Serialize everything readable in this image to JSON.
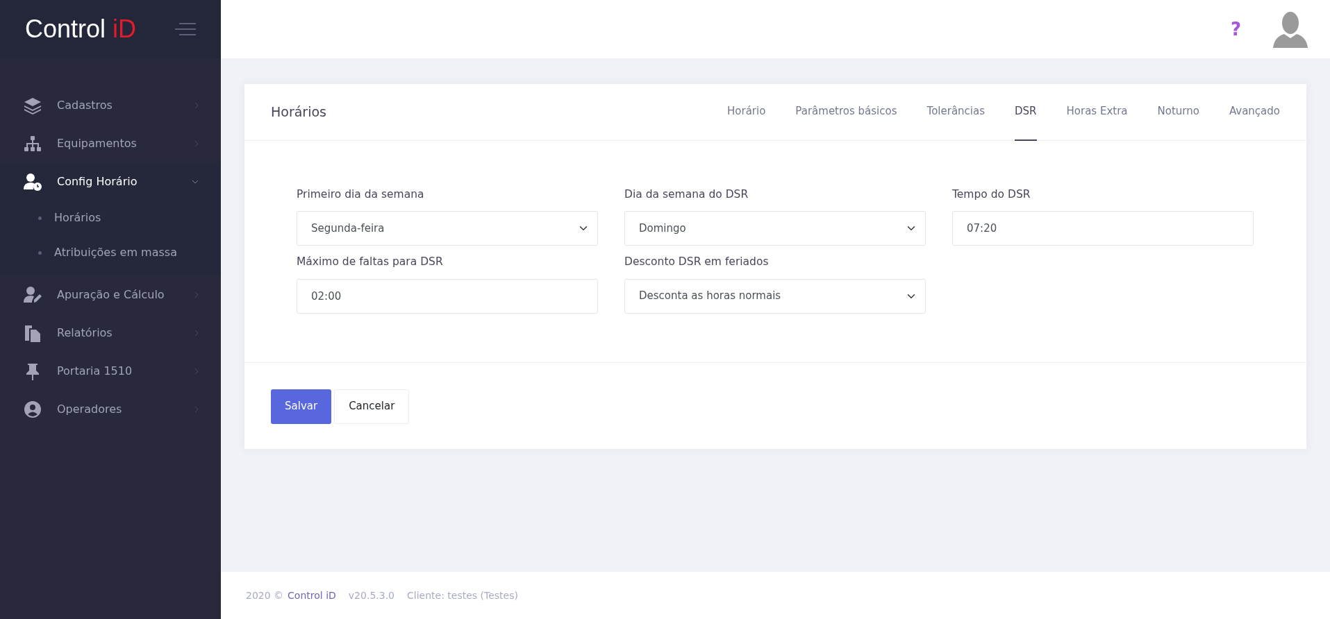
{
  "logo": {
    "text": "Control",
    "accent": "iD"
  },
  "sidebar": {
    "items": [
      {
        "label": "Cadastros",
        "expanded": false
      },
      {
        "label": "Equipamentos",
        "expanded": false
      },
      {
        "label": "Config Horário",
        "expanded": true,
        "children": [
          {
            "label": "Horários"
          },
          {
            "label": "Atribuições em massa"
          }
        ]
      },
      {
        "label": "Apuração e Cálculo",
        "expanded": false
      },
      {
        "label": "Relatórios",
        "expanded": false
      },
      {
        "label": "Portaria 1510",
        "expanded": false
      },
      {
        "label": "Operadores",
        "expanded": false
      }
    ]
  },
  "header": {
    "help": "?"
  },
  "card": {
    "title": "Horários",
    "tabs": [
      {
        "label": "Horário",
        "selected": false
      },
      {
        "label": "Parâmetros básicos",
        "selected": false
      },
      {
        "label": "Tolerâncias",
        "selected": false
      },
      {
        "label": "DSR",
        "selected": true
      },
      {
        "label": "Horas Extra",
        "selected": false
      },
      {
        "label": "Noturno",
        "selected": false
      },
      {
        "label": "Avançado",
        "selected": false
      }
    ],
    "fields": [
      {
        "label": "Primeiro dia da semana",
        "kind": "select",
        "value": "Segunda-feira"
      },
      {
        "label": "Dia da semana do DSR",
        "kind": "select",
        "value": "Domingo"
      },
      {
        "label": "Tempo do DSR",
        "kind": "text",
        "value": "07:20"
      },
      {
        "label": "Máximo de faltas para DSR",
        "kind": "text",
        "value": "02:00"
      },
      {
        "label": "Desconto DSR em feriados",
        "kind": "select",
        "value": "Desconta as horas normais"
      }
    ],
    "buttons": [
      {
        "label": "Salvar",
        "kind": "primary"
      },
      {
        "label": "Cancelar",
        "kind": "secondary"
      }
    ]
  },
  "footer": {
    "year": "2020 ©",
    "company": "Control iD",
    "version": "v20.5.3.0",
    "client": "Cliente: testes (Testes)"
  }
}
